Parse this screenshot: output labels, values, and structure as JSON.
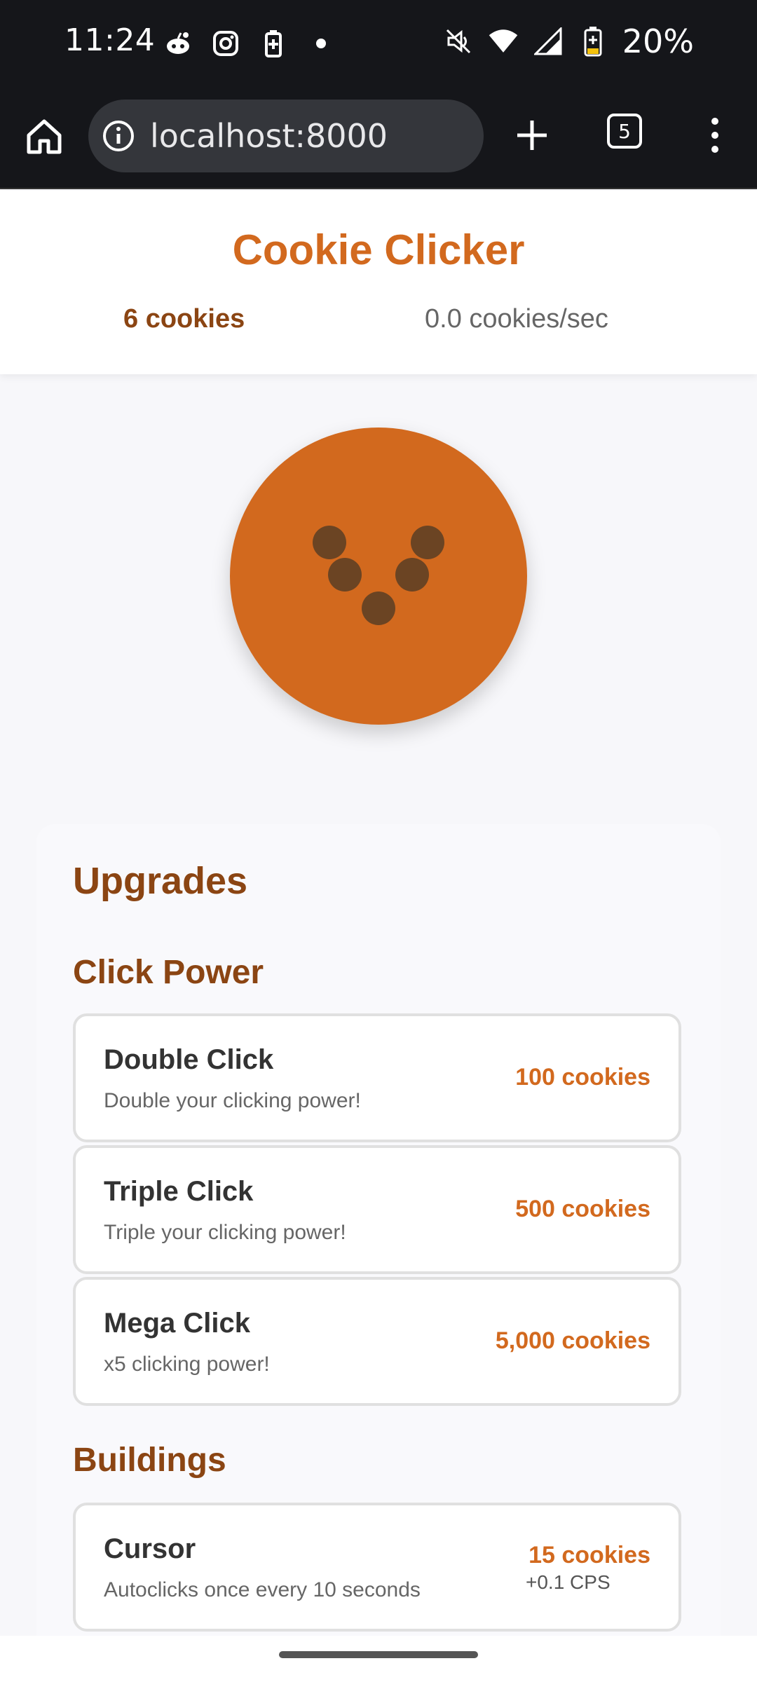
{
  "status_bar": {
    "time": "11:24",
    "battery_percent": "20%",
    "left_icons": [
      "reddit-icon",
      "instagram-icon",
      "battery-saver-icon",
      "dot-icon"
    ],
    "right_icons": [
      "mute-icon",
      "wifi-icon",
      "signal-icon",
      "battery-icon"
    ]
  },
  "browser": {
    "url": "localhost:8000",
    "tab_count": "5"
  },
  "header": {
    "title": "Cookie Clicker",
    "cookies": "6 cookies",
    "cps": "0.0 cookies/sec"
  },
  "upgrades": {
    "title": "Upgrades",
    "click_power": {
      "title": "Click Power",
      "items": [
        {
          "name": "Double Click",
          "desc": "Double your clicking power!",
          "price": "100 cookies"
        },
        {
          "name": "Triple Click",
          "desc": "Triple your clicking power!",
          "price": "500 cookies"
        },
        {
          "name": "Mega Click",
          "desc": "x5 clicking power!",
          "price": "5,000 cookies"
        }
      ]
    },
    "buildings": {
      "title": "Buildings",
      "items": [
        {
          "name": "Cursor",
          "desc": "Autoclicks once every 10 seconds",
          "price": "15 cookies",
          "cps": "+0.1 CPS"
        }
      ]
    }
  },
  "colors": {
    "accent": "#d2691e",
    "heading": "#8b4513",
    "chip": "#6b4423"
  }
}
